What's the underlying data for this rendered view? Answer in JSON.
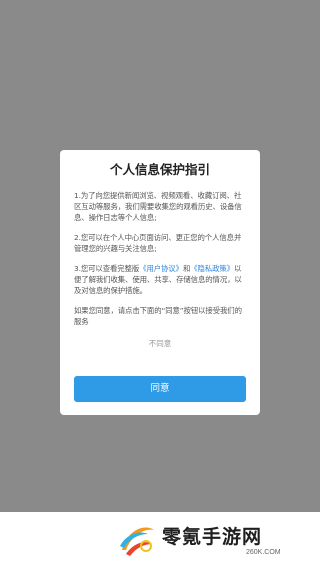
{
  "dialog": {
    "title": "个人信息保护指引",
    "p1": "1.为了向您提供新闻浏览、视频观看、收藏订阅、社区互动等服务，我们需要收集您的观看历史、设备信息、操作日志等个人信息;",
    "p2": "2.您可以在个人中心页面访问、更正您的个人信息并管理您的兴趣与关注信息;",
    "p3_prefix": "3.您可以查看完整版",
    "user_agreement_link": "《用户协议》",
    "p3_and": "和",
    "privacy_policy_link": "《隐私政策》",
    "p3_suffix": "以便了解我们收集、使用、共享、存储信息的情况，以及对信息的保护措施。",
    "p4": "如果您同意，请点击下面的“同意”按钮以接受我们的服务",
    "disagree_label": "不同意",
    "agree_label": "同意"
  },
  "watermark": {
    "brand": "零氪手游网",
    "url": "260K.COM"
  },
  "colors": {
    "overlay": "#8a8a8a",
    "link": "#2f86de",
    "button": "#2f9ae6"
  }
}
